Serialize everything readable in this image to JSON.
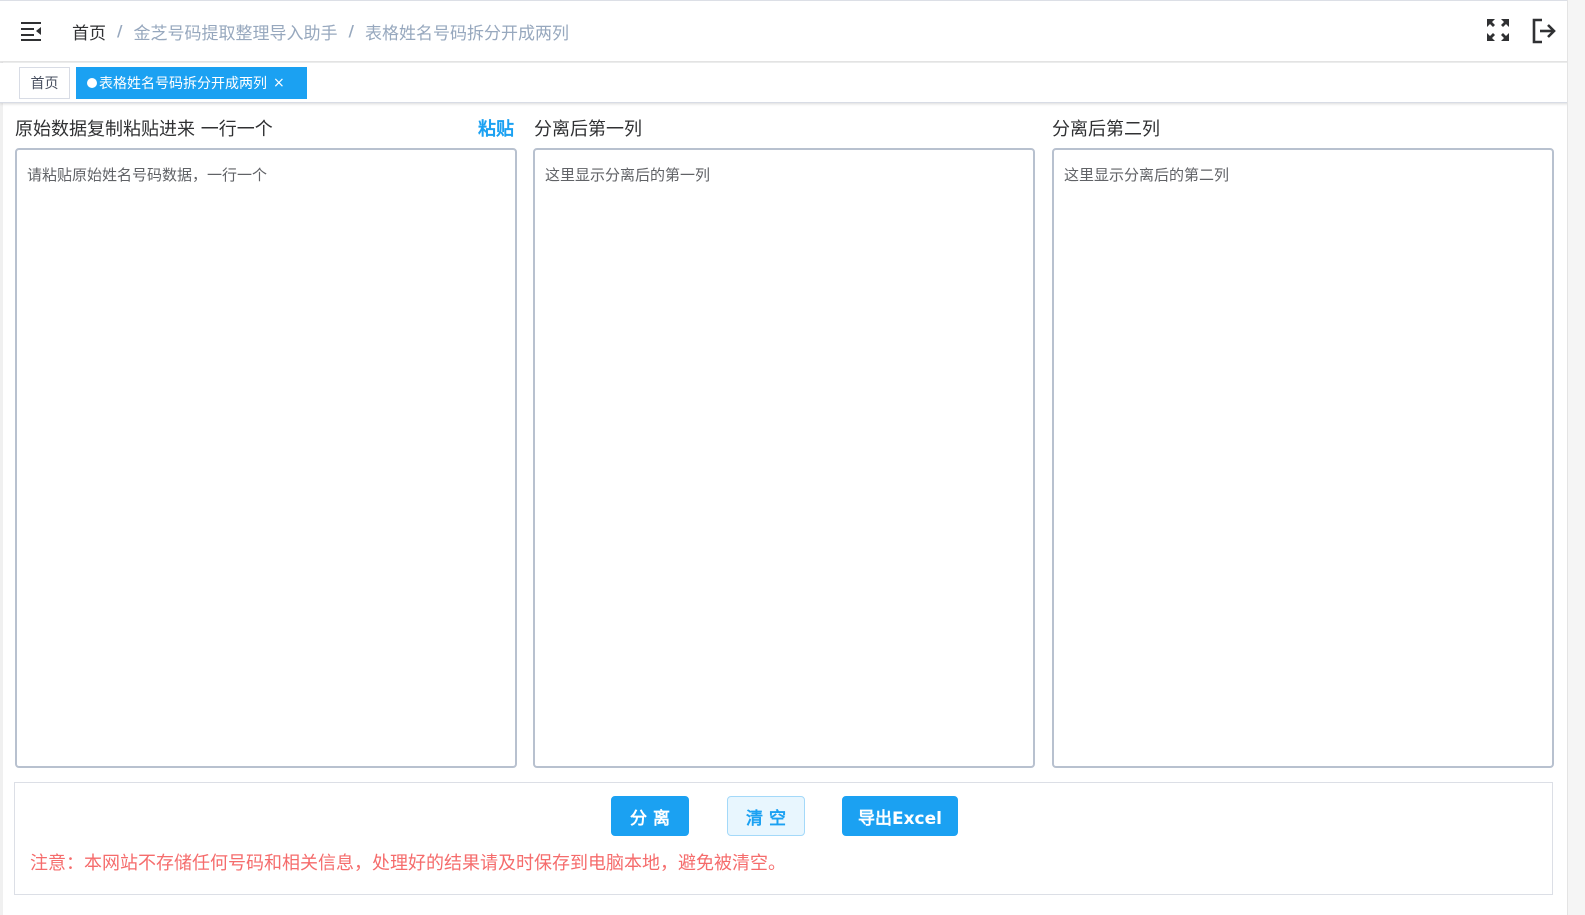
{
  "breadcrumb": {
    "home": "首页",
    "parent": "金芝号码提取整理导入助手",
    "current": "表格姓名号码拆分开成两列",
    "separator": "/"
  },
  "tags": {
    "home_label": "首页",
    "active_label": "表格姓名号码拆分开成两列",
    "close_symbol": "×"
  },
  "input_column": {
    "label": "原始数据复制粘贴进来 一行一个",
    "paste_label": "粘贴",
    "placeholder": "请粘贴原始姓名号码数据，一行一个"
  },
  "output_column_1": {
    "label": "分离后第一列",
    "placeholder": "这里显示分离后的第一列"
  },
  "output_column_2": {
    "label": "分离后第二列",
    "placeholder": "这里显示分离后的第二列"
  },
  "actions": {
    "split_label": "分 离",
    "clear_label": "清 空",
    "export_label": "导出Excel"
  },
  "notice": "注意：本网站不存储任何号码和相关信息，处理好的结果请及时保存到电脑本地，避免被清空。",
  "icons": {
    "menu": "hamburger-fold-icon",
    "fullscreen": "fullscreen-icon",
    "logout": "logout-icon"
  },
  "colors": {
    "primary": "#1ba1f2",
    "danger_text": "#f56c6c",
    "breadcrumb_muted": "#97a8be",
    "textarea_border": "#b8c1cf"
  }
}
